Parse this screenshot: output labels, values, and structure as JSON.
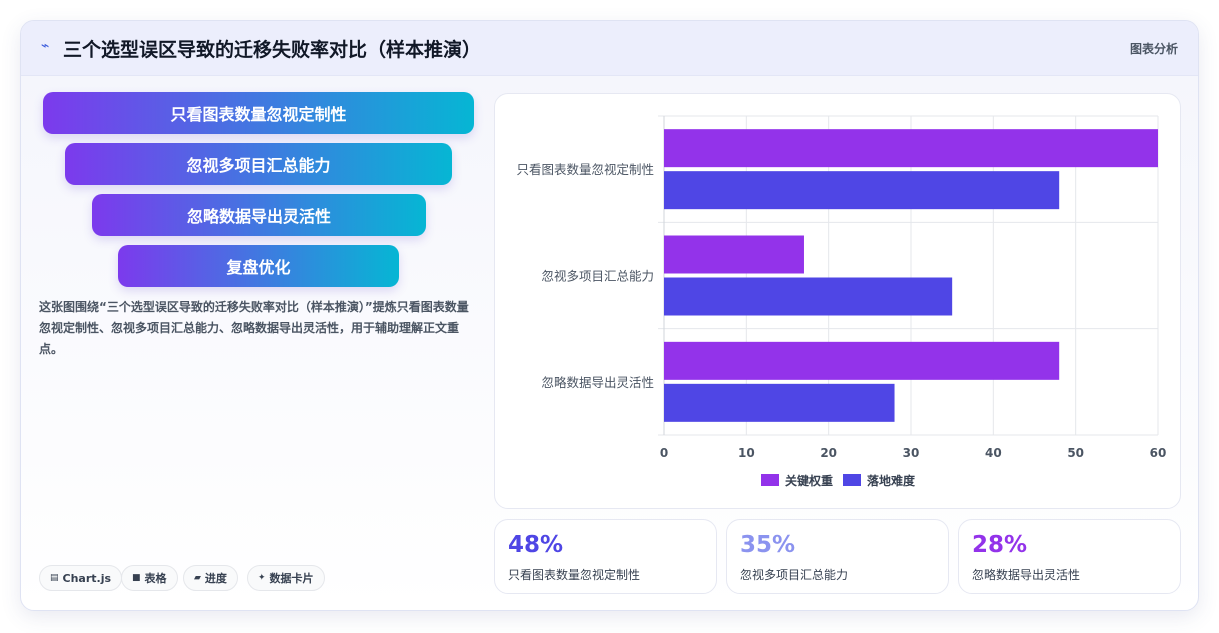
{
  "header": {
    "title": "三个选型误区导致的迁移失败率对比（样本推演）",
    "tag": "图表分析",
    "icon": "trend-icon"
  },
  "funnel": {
    "items": [
      "只看图表数量忽视定制性",
      "忽视多项目汇总能力",
      "忽略数据导出灵活性",
      "复盘优化"
    ]
  },
  "description": "这张图围绕“三个选型误区导致的迁移失败率对比（样本推演）”提炼只看图表数量忽视定制性、忽视多项目汇总能力、忽略数据导出灵活性，用于辅助理解正文重点。",
  "pills": [
    {
      "icon": "chart-icon",
      "glyph": "▤",
      "label": "Chart.js"
    },
    {
      "icon": "table-icon",
      "glyph": "■",
      "label": "表格"
    },
    {
      "icon": "progress-icon",
      "glyph": "▰",
      "label": "进度"
    },
    {
      "icon": "sparkle-icon",
      "glyph": "✦",
      "label": "数据卡片"
    }
  ],
  "stats": [
    {
      "value": "48%",
      "label": "只看图表数量忽视定制性",
      "color": "#4f46e5"
    },
    {
      "value": "35%",
      "label": "忽视多项目汇总能力",
      "color": "#8b93ef"
    },
    {
      "value": "28%",
      "label": "忽略数据导出灵活性",
      "color": "#9333ea"
    }
  ],
  "chart_data": {
    "type": "bar",
    "orientation": "horizontal",
    "categories": [
      "只看图表数量忽视定制性",
      "忽视多项目汇总能力",
      "忽略数据导出灵活性"
    ],
    "series": [
      {
        "name": "关键权重",
        "values": [
          60,
          17,
          48
        ],
        "color": "#9333ea"
      },
      {
        "name": "落地难度",
        "values": [
          48,
          35,
          28
        ],
        "color": "#4f46e5"
      }
    ],
    "xlim": [
      0,
      60
    ],
    "ticks": [
      "0",
      "10",
      "20",
      "30",
      "40",
      "50",
      "60"
    ],
    "grid": true,
    "legend": "bottom"
  }
}
